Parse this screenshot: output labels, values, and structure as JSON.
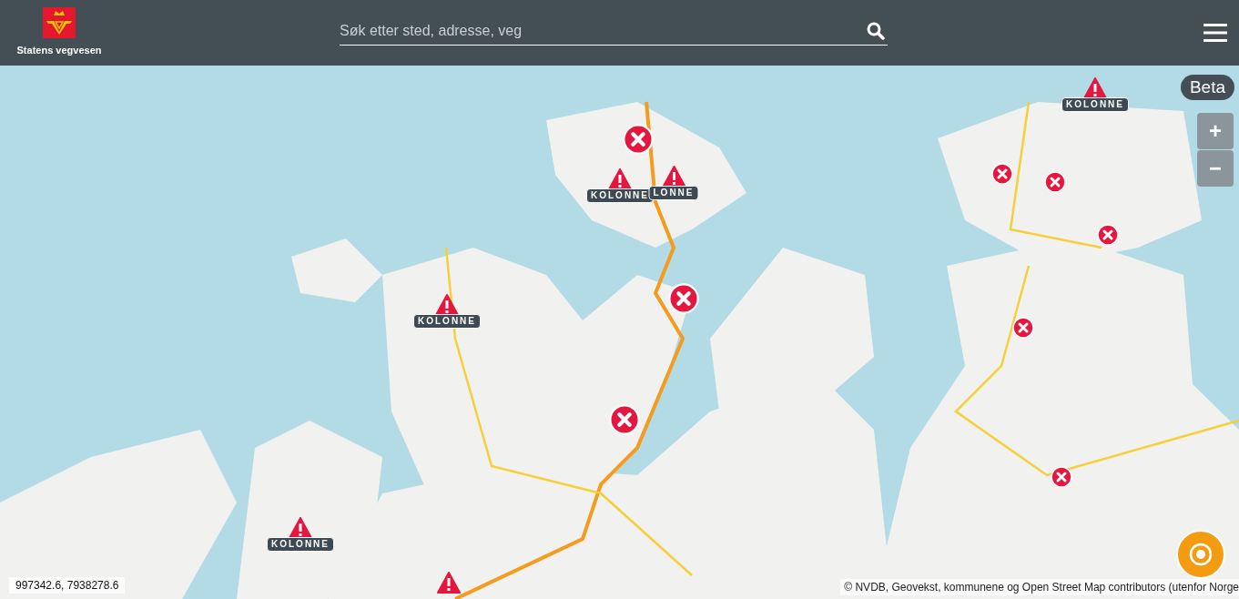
{
  "header": {
    "logo_text": "Statens vegvesen",
    "search": {
      "placeholder": "Søk etter sted, adresse, veg"
    }
  },
  "badge": "Beta",
  "zoom_buttons": [
    "+",
    "−"
  ],
  "markers": [
    {
      "kind": "warning",
      "label": "KOLONNE"
    },
    {
      "kind": "closed"
    },
    {
      "kind": "warning",
      "label": "LONNE"
    },
    {
      "kind": "warning",
      "label": "KOLONNE"
    },
    {
      "kind": "warning",
      "label": "KOLONNE"
    },
    {
      "kind": "closed"
    },
    {
      "kind": "closed"
    },
    {
      "kind": "closed"
    },
    {
      "kind": "closed"
    },
    {
      "kind": "closed"
    },
    {
      "kind": "closed"
    },
    {
      "kind": "warning",
      "label": "KOLONNE"
    },
    {
      "kind": "closed"
    },
    {
      "kind": "warning"
    }
  ],
  "coordinates": "997342.6, 7938278.6",
  "attribution": "© NVDB, Geovekst, kommunene og Open Street Map contributors (utenfor Norge"
}
